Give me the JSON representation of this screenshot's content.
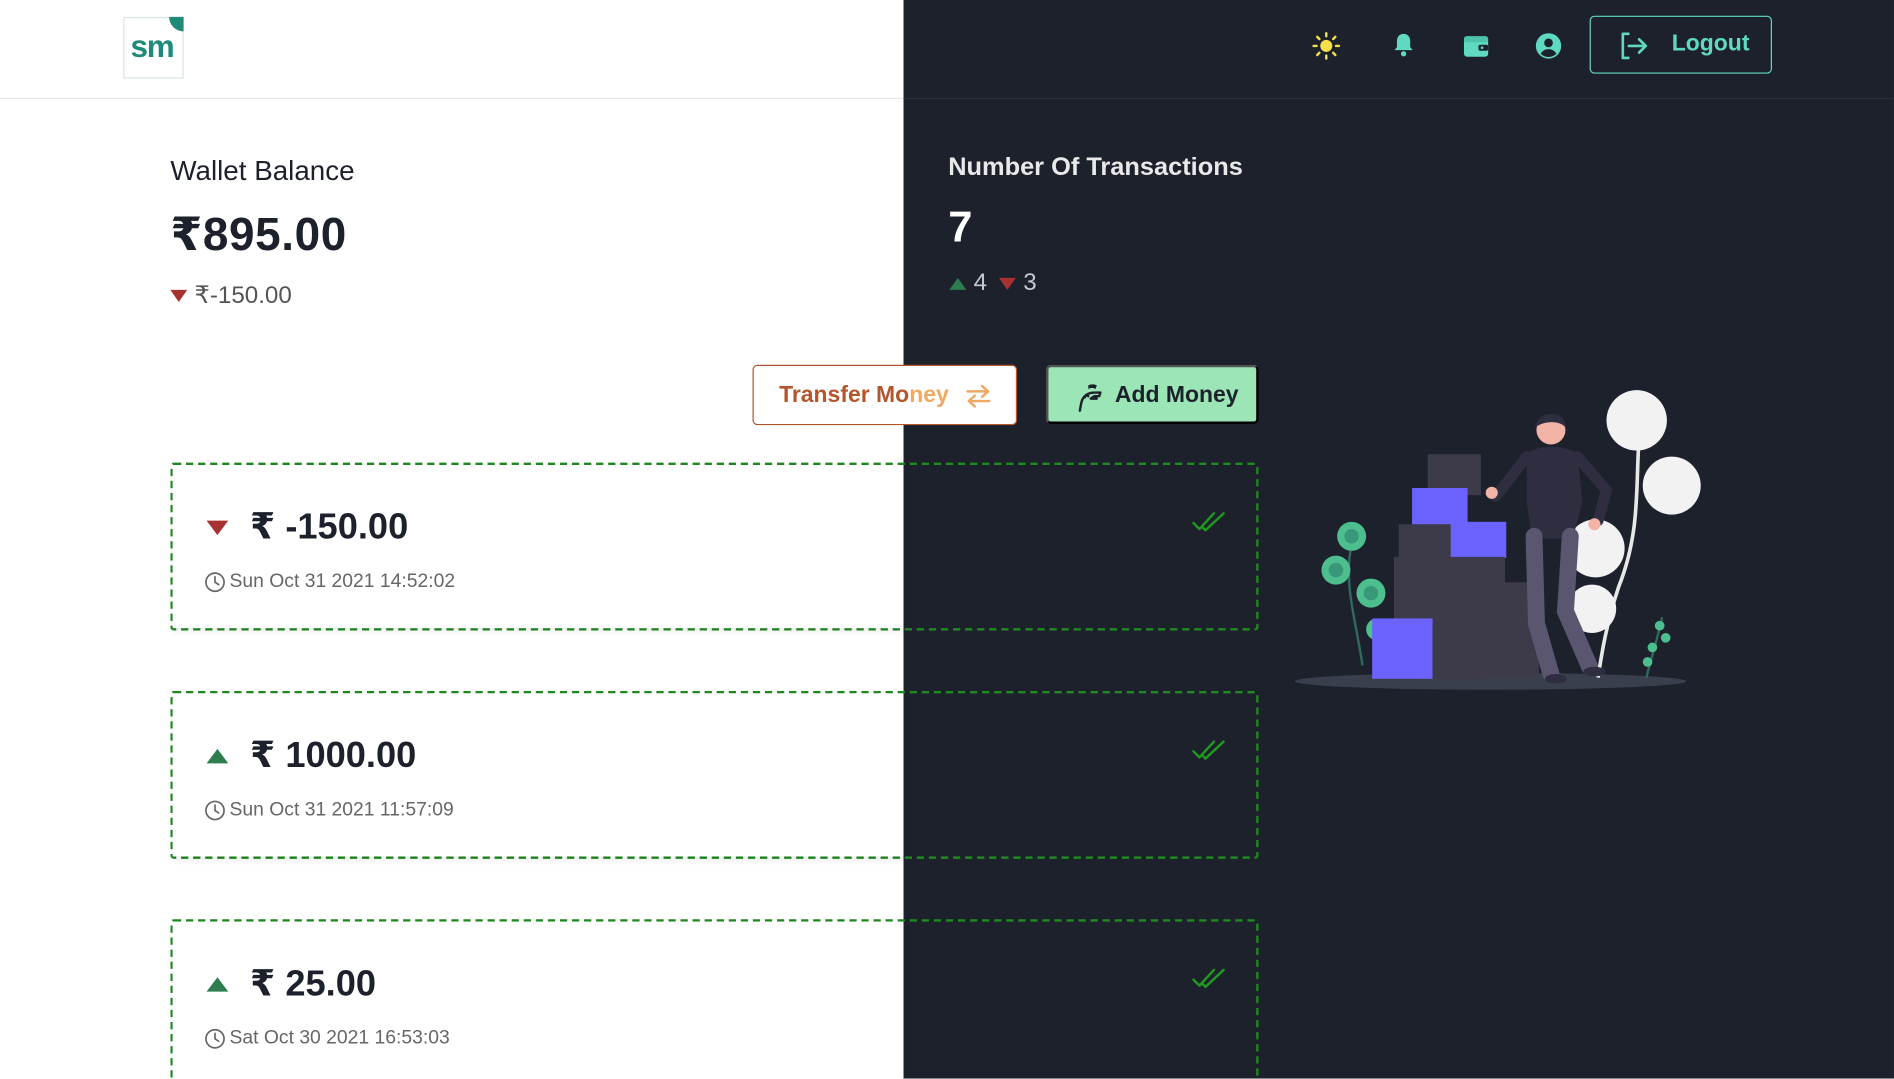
{
  "header": {
    "logo_text": "sm",
    "icons": [
      "theme-sun-icon",
      "bell-icon",
      "wallet-icon",
      "user-icon"
    ],
    "logout_label": "Logout"
  },
  "wallet": {
    "title": "Wallet Balance",
    "balance": "₹895.00",
    "change": "₹-150.00"
  },
  "transactions_summary": {
    "title": "Number Of Transactions",
    "count": "7",
    "up_count": "4",
    "down_count": "3"
  },
  "actions": {
    "transfer_label_a": "Transfer Mo",
    "transfer_label_b": "ney",
    "add_label": "Add Money"
  },
  "transactions": [
    {
      "direction": "down",
      "amount": "₹ -150.00",
      "time": "Sun Oct 31 2021 14:52:02"
    },
    {
      "direction": "up",
      "amount": "₹ 1000.00",
      "time": "Sun Oct 31 2021 11:57:09"
    },
    {
      "direction": "up",
      "amount": "₹ 25.00",
      "time": "Sat Oct 30 2021 16:53:03"
    }
  ],
  "colors": {
    "dark_bg": "#1d212c",
    "accent_teal": "#5fd9c2",
    "up_green": "#2e7d4f",
    "down_red": "#a83232",
    "add_green": "#9be5b6",
    "transfer_orange": "#b4562c",
    "card_border": "#1f8a1f"
  }
}
